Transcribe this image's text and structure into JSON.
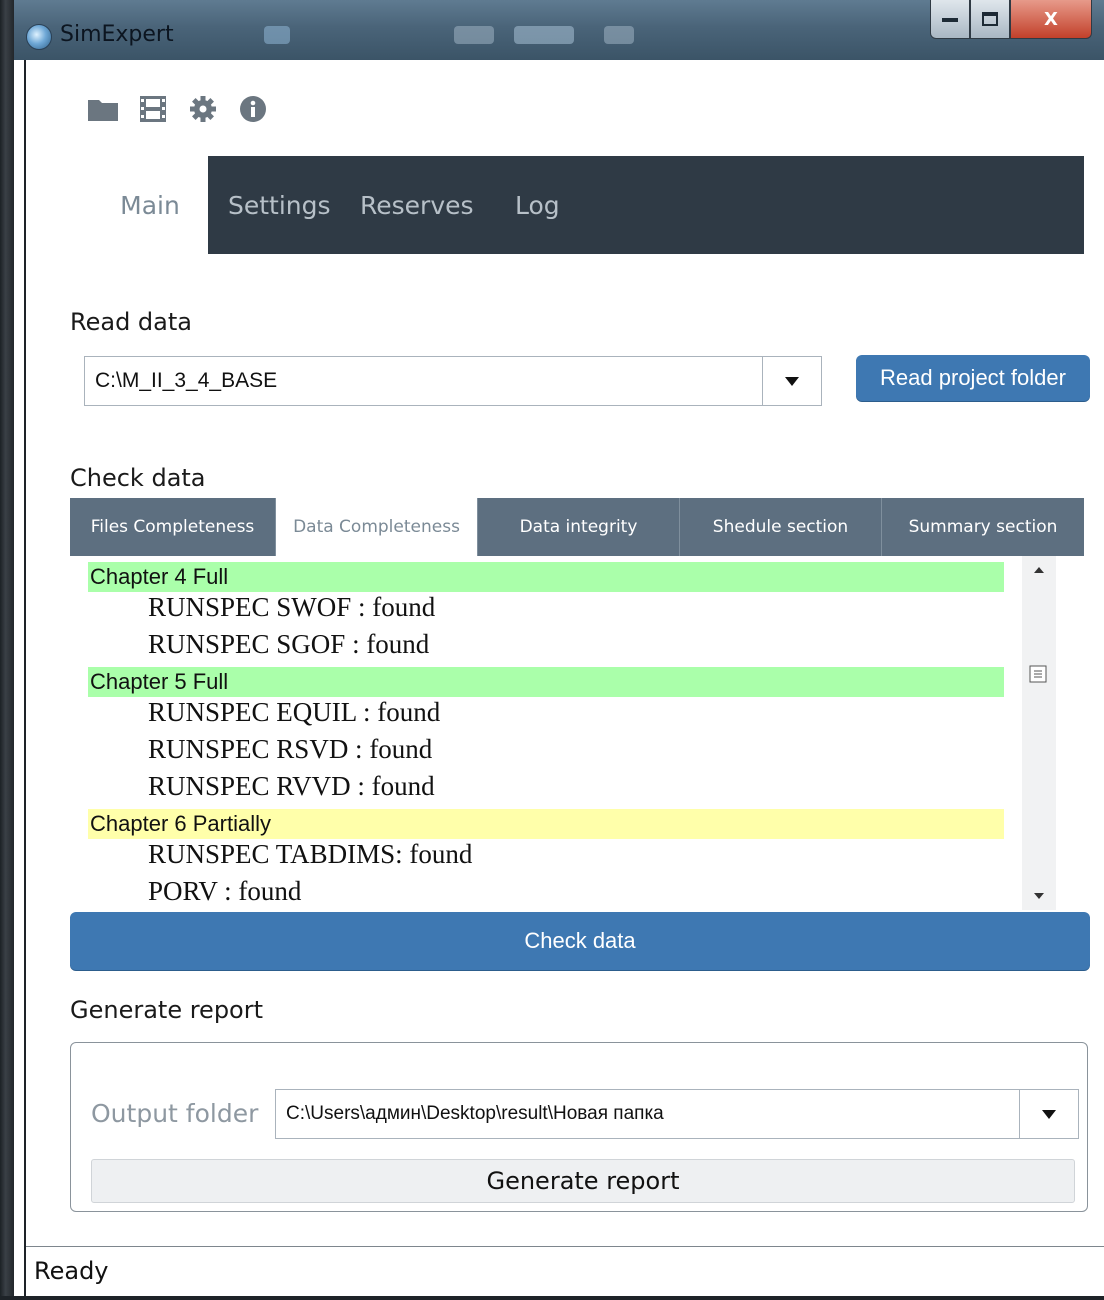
{
  "window": {
    "title": "SimExpert",
    "controls": {
      "minimize": "—",
      "maximize": "□",
      "close": "X"
    }
  },
  "toolbar": {
    "icons": [
      "folder-icon",
      "film-icon",
      "gear-icon",
      "info-icon"
    ]
  },
  "main_tabs": {
    "items": [
      {
        "label": "Main",
        "active": true
      },
      {
        "label": "Settings",
        "active": false
      },
      {
        "label": "Reserves",
        "active": false
      },
      {
        "label": "Log",
        "active": false
      }
    ]
  },
  "read_data": {
    "heading": "Read data",
    "path_value": "C:\\M_II_3_4_BASE",
    "button": "Read project folder"
  },
  "check_data": {
    "heading": "Check data",
    "tabs": [
      {
        "label": "Files Completeness",
        "active": false
      },
      {
        "label": "Data Completeness",
        "active": true
      },
      {
        "label": "Data integrity",
        "active": false
      },
      {
        "label": "Shedule section",
        "active": false
      },
      {
        "label": "Summary section",
        "active": false
      }
    ],
    "rows": [
      {
        "kind": "chapter",
        "text": "Chapter 4 Full",
        "color": "#aaffaa"
      },
      {
        "kind": "item",
        "text": "RUNSPEC SWOF : found"
      },
      {
        "kind": "item",
        "text": "RUNSPEC SGOF : found"
      },
      {
        "kind": "chapter",
        "text": "Chapter 5 Full",
        "color": "#aaffaa"
      },
      {
        "kind": "item",
        "text": "RUNSPEC EQUIL : found"
      },
      {
        "kind": "item",
        "text": "RUNSPEC RSVD : found"
      },
      {
        "kind": "item",
        "text": "RUNSPEC RVVD : found"
      },
      {
        "kind": "chapter",
        "text": "Chapter 6 Partially",
        "color": "#ffffaa"
      },
      {
        "kind": "item",
        "text": "RUNSPEC TABDIMS: found"
      },
      {
        "kind": "item",
        "text": "PORV : found"
      }
    ],
    "button": "Check data"
  },
  "generate_report": {
    "heading": "Generate report",
    "output_label": "Output folder",
    "output_value": "C:\\Users\\админ\\Desktop\\result\\Новая папка",
    "button": "Generate report"
  },
  "status": {
    "text": "Ready"
  },
  "colors": {
    "accent": "#3e78b2",
    "tab_bar": "#2f3a45",
    "subtab": "#5d6f80",
    "full": "#aaffaa",
    "partial": "#ffffaa"
  }
}
